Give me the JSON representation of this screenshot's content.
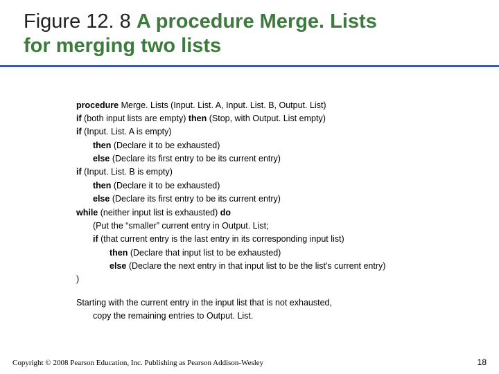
{
  "title": {
    "figure_label": "Figure 12. 8",
    "spacer": "  ",
    "main_a": "A procedure Merge. Lists",
    "main_b": "for merging two lists"
  },
  "code": {
    "l01_kw": "procedure",
    "l01_rest": " Merge. Lists (Input. List. A, Input. List. B, Output. List)",
    "l02_kw1": "if",
    "l02_mid": " (both input lists are empty) ",
    "l02_kw2": "then",
    "l02_tail": " (Stop, with Output. List empty)",
    "l03_kw": "if",
    "l03_rest": " (Input. List. A is empty)",
    "l04_kw": "then",
    "l04_rest": " (Declare it to be exhausted)",
    "l05_kw": "else",
    "l05_rest": " (Declare its first entry to be its current entry)",
    "l06_kw": "if",
    "l06_rest": " (Input. List. B is empty)",
    "l07_kw": "then",
    "l07_rest": " (Declare it to be exhausted)",
    "l08_kw": "else",
    "l08_rest": " (Declare its first entry to be its current entry)",
    "l09_kw1": "while",
    "l09_mid": " (neither input list is exhausted) ",
    "l09_kw2": "do",
    "l10": "(Put the “smaller” current entry in Output. List;",
    "l11_kw": "if",
    "l11_rest": " (that current entry is the last entry in its corresponding input list)",
    "l12_kw": "then",
    "l12_rest": " (Declare that input list to be exhausted)",
    "l13_kw": "else",
    "l13_rest": " (Declare the next entry in that input list to be the list's current entry)",
    "l14": ")",
    "note_a": "Starting with the current entry in the input list that is not exhausted,",
    "note_b": "copy the remaining entries to Output. List."
  },
  "footer": {
    "copyright": "Copyright © 2008 Pearson Education, Inc. Publishing as Pearson Addison-Wesley",
    "page": "18"
  }
}
